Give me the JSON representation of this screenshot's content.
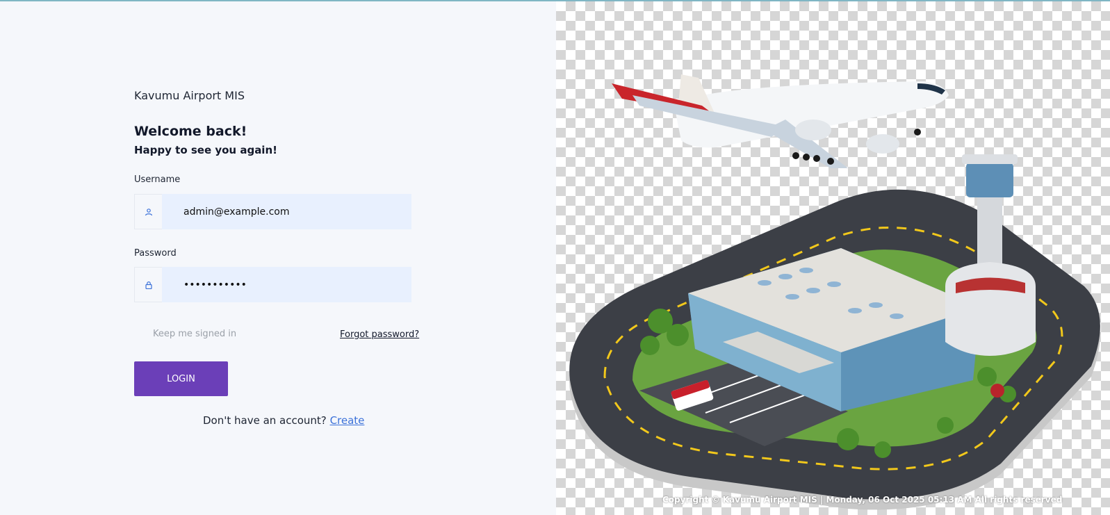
{
  "brand": {
    "name": "Kavumu Airport MIS"
  },
  "heading": {
    "title": "Welcome back!",
    "subtitle": "Happy to see you again!"
  },
  "form": {
    "username": {
      "label": "Username",
      "value": "admin@example.com",
      "icon": "user-icon"
    },
    "password": {
      "label": "Password",
      "value": "•••••••••••",
      "icon": "lock-icon"
    },
    "remember_label": "Keep me signed in",
    "forgot_label": "Forgot password?",
    "login_label": "LOGIN"
  },
  "signup": {
    "prompt": "Don't have an account?",
    "link": "Create"
  },
  "footer": {
    "text": "Copyright © Kavumu Airport MIS | Monday, 06 Oct 2025 05:13 AM All rights reserved"
  },
  "colors": {
    "accent": "#6b3fb8",
    "link": "#3b71d9",
    "input_bg": "#e8f0fe",
    "page_bg": "#f5f7fb"
  }
}
